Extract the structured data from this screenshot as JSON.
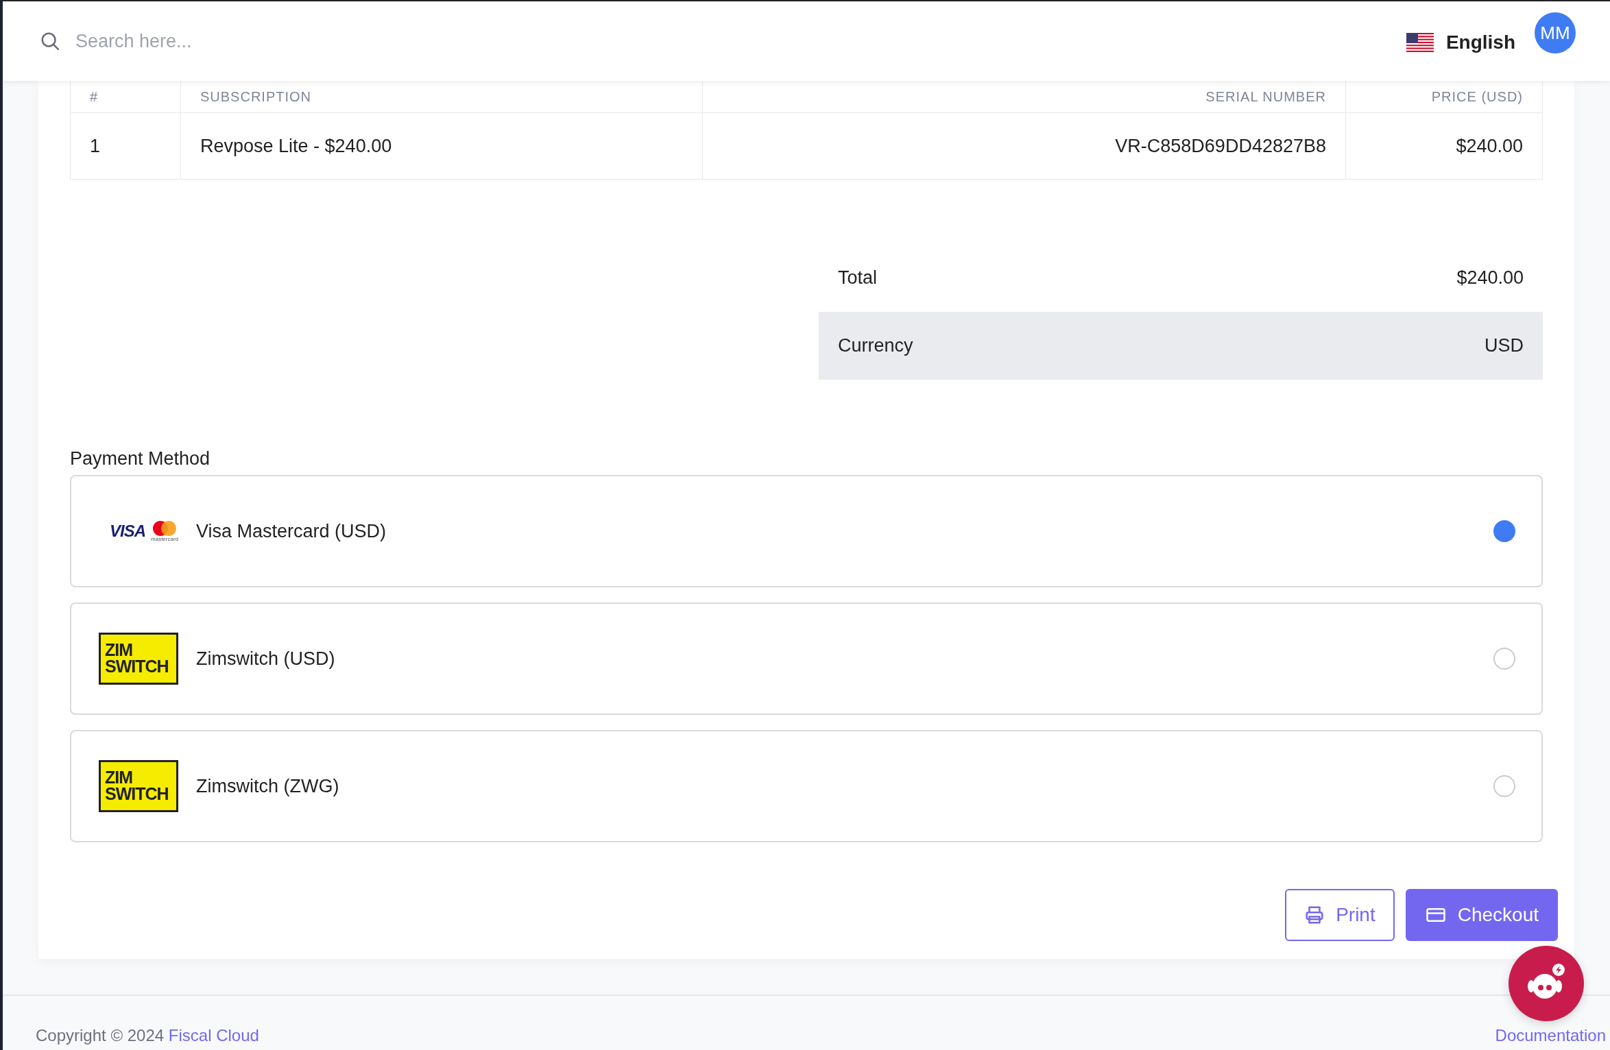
{
  "header": {
    "search": {
      "placeholder": "Search here..."
    },
    "language": "English",
    "avatar": "MM"
  },
  "table": {
    "columns": [
      "#",
      "SUBSCRIPTION",
      "SERIAL NUMBER",
      "PRICE (USD)"
    ],
    "rows": [
      [
        "1",
        "Revpose Lite - $240.00",
        "VR-C858D69DD42827B8",
        "$240.00"
      ]
    ]
  },
  "summary": [
    {
      "label": "Total",
      "value": "$240.00",
      "shaded": false
    },
    {
      "label": "Currency",
      "value": "USD",
      "shaded": true
    }
  ],
  "payment": {
    "label": "Payment Method",
    "options": [
      {
        "kind": "visa-mastercard",
        "logo_text": [
          "VISA",
          "mastercard"
        ],
        "label": "Visa Mastercard (USD)",
        "selected": true
      },
      {
        "kind": "zimswitch",
        "logo_text": [
          "ZIM",
          "SWITCH"
        ],
        "label": "Zimswitch (USD)",
        "selected": false
      },
      {
        "kind": "zimswitch",
        "logo_text": [
          "ZIM",
          "SWITCH"
        ],
        "label": "Zimswitch (ZWG)",
        "selected": false
      }
    ]
  },
  "actions": {
    "print": "Print",
    "checkout": "Checkout"
  },
  "footer": {
    "copyright": "Copyright © 2024",
    "brand": "Fiscal Cloud",
    "link": "Documentation"
  }
}
